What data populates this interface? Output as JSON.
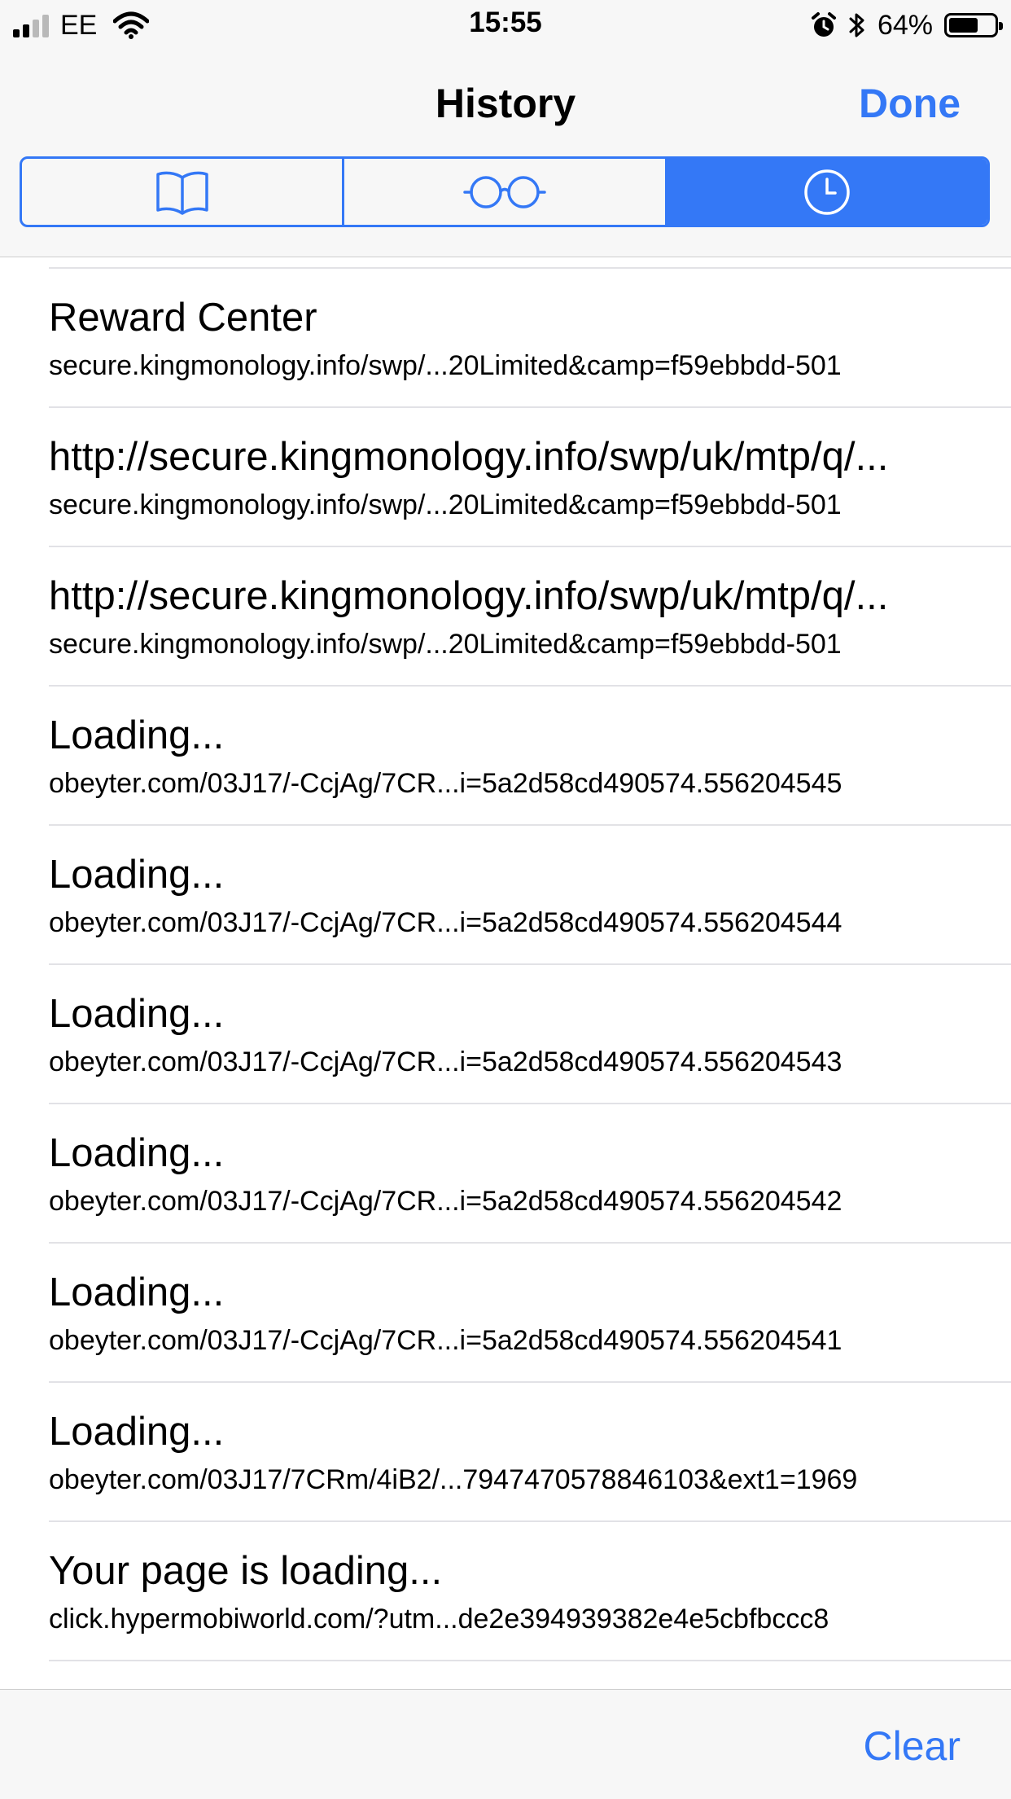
{
  "status_bar": {
    "carrier": "EE",
    "time": "15:55",
    "battery_percent": "64%",
    "battery_level": 0.64,
    "signal_bars": 2,
    "icons": [
      "cellular-signal-icon",
      "wifi-icon",
      "alarm-icon",
      "bluetooth-icon",
      "battery-icon"
    ]
  },
  "header": {
    "title": "History",
    "done_label": "Done"
  },
  "segments": [
    {
      "icon": "bookmarks-book-icon",
      "selected": false
    },
    {
      "icon": "reading-list-glasses-icon",
      "selected": false
    },
    {
      "icon": "history-clock-icon",
      "selected": true
    }
  ],
  "history": [
    {
      "title": "Reward Center",
      "url": "secure.kingmonology.info/swp/...20Limited&camp=f59ebbdd-501"
    },
    {
      "title": "http://secure.kingmonology.info/swp/uk/mtp/q/...",
      "url": "secure.kingmonology.info/swp/...20Limited&camp=f59ebbdd-501"
    },
    {
      "title": "http://secure.kingmonology.info/swp/uk/mtp/q/...",
      "url": "secure.kingmonology.info/swp/...20Limited&camp=f59ebbdd-501"
    },
    {
      "title": "Loading...",
      "url": "obeyter.com/03J17/-CcjAg/7CR...i=5a2d58cd490574.556204545"
    },
    {
      "title": "Loading...",
      "url": "obeyter.com/03J17/-CcjAg/7CR...i=5a2d58cd490574.556204544"
    },
    {
      "title": "Loading...",
      "url": "obeyter.com/03J17/-CcjAg/7CR...i=5a2d58cd490574.556204543"
    },
    {
      "title": "Loading...",
      "url": "obeyter.com/03J17/-CcjAg/7CR...i=5a2d58cd490574.556204542"
    },
    {
      "title": "Loading...",
      "url": "obeyter.com/03J17/-CcjAg/7CR...i=5a2d58cd490574.556204541"
    },
    {
      "title": "Loading...",
      "url": "obeyter.com/03J17/7CRm/4iB2/...7947470578846103&ext1=1969"
    },
    {
      "title": "Your page is loading...",
      "url": "click.hypermobiworld.com/?utm...de2e394939382e4e5cbfbccc8"
    }
  ],
  "toolbar": {
    "clear_label": "Clear"
  },
  "colors": {
    "accent": "#3478f6",
    "bar_background": "#f7f7f7",
    "separator": "#e2e2e6"
  }
}
